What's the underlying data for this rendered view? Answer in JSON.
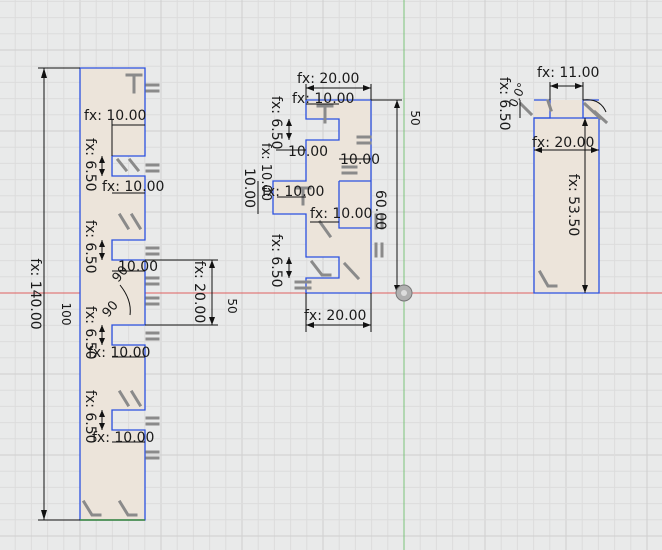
{
  "sketch": {
    "grid_minor_color": "#dcdcdc",
    "grid_major_color": "#cfcfcf",
    "x_axis_color": "#e06060",
    "y_axis_color": "#7ac47a",
    "edge_color": "#2b50e0",
    "face_color": "#ece4da"
  },
  "dims": {
    "d140": "fx: 140.00",
    "d100": "100",
    "d10a": "fx: 10.00",
    "d650a": "fx: 6.50",
    "d10b": "fx: 10.00",
    "d650b": "fx: 6.50",
    "d10c": "10.00",
    "d650c": "fx: 6.50",
    "d10d": "fx: 10.00",
    "d650d": "fx: 6.50",
    "d10e": "fx: 10.00",
    "d90a": "90",
    "d90b": "90",
    "d20v": "fx: 20.00",
    "d50a": "50",
    "d20top": "fx: 20.00",
    "d10t": "fx: 10.00",
    "d650t": "fx: 6.50",
    "d10ma": "10.00",
    "d10mb": "10.00",
    "d10mc": "fx: 10.00",
    "d10left": "fx: 10.00",
    "d10md": "fx: 10.00",
    "d650m": "fx: 6.50",
    "d10me": "10.00",
    "d60": "60.00",
    "d50b": "50",
    "d20bot": "fx: 20.00",
    "d11": "fx: 11.00",
    "d650r": "fx: 6.50",
    "dang": "0.0°",
    "d20r": "fx: 20.00",
    "d535": "fx: 53.50"
  }
}
